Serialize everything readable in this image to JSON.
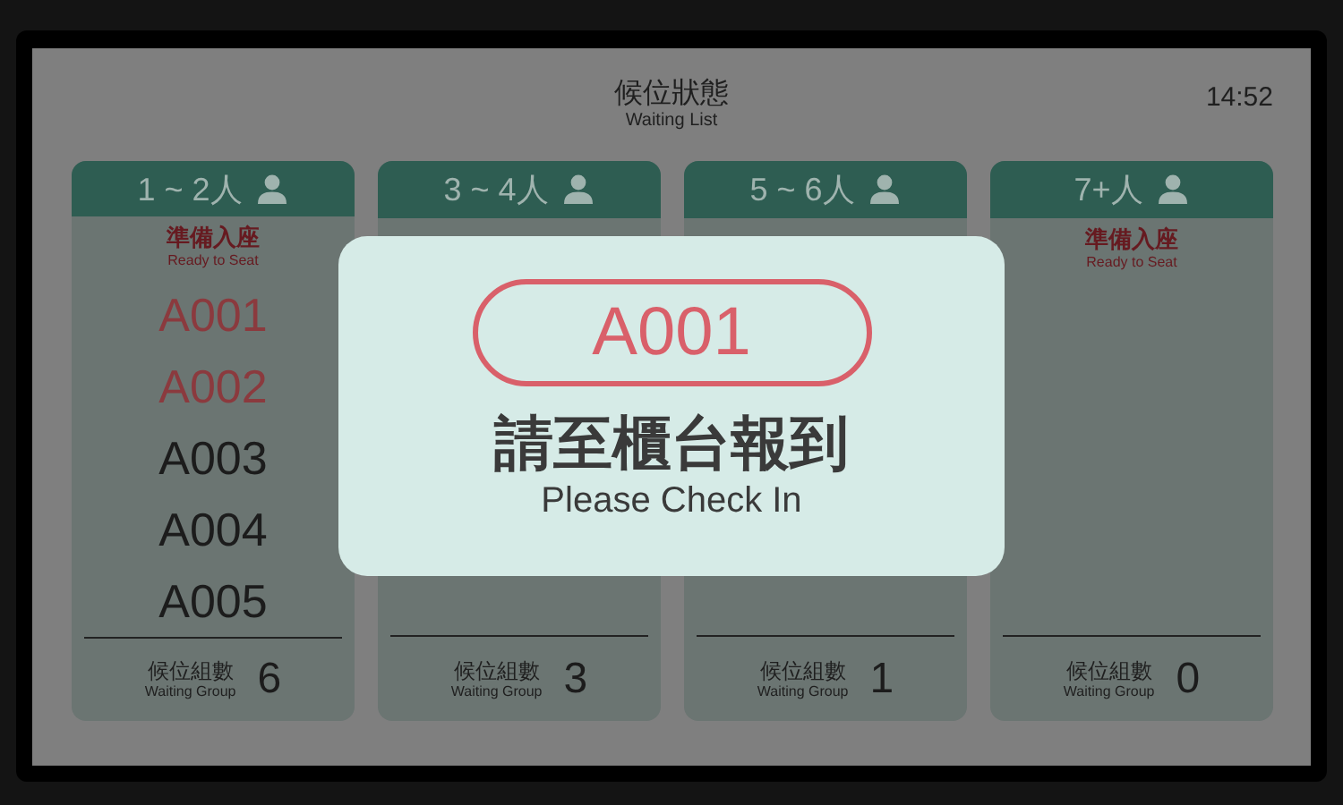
{
  "header": {
    "title": "候位狀態",
    "subtitle": "Waiting List",
    "time": "14:52"
  },
  "columns": [
    {
      "label": "1 ~ 2人",
      "ready_label": "準備入座",
      "ready_sublabel": "Ready to Seat",
      "tickets": [
        {
          "number": "A001",
          "called": true
        },
        {
          "number": "A002",
          "called": true
        },
        {
          "number": "A003",
          "called": false
        },
        {
          "number": "A004",
          "called": false
        },
        {
          "number": "A005",
          "called": false
        }
      ],
      "count_label": "候位組數",
      "count_sublabel": "Waiting Group",
      "count": "6"
    },
    {
      "label": "3 ~ 4人",
      "count_label": "候位組數",
      "count_sublabel": "Waiting Group",
      "count": "3"
    },
    {
      "label": "5 ~ 6人",
      "count_label": "候位組數",
      "count_sublabel": "Waiting Group",
      "count": "1"
    },
    {
      "label": "7+人",
      "ready_label": "準備入座",
      "ready_sublabel": "Ready to Seat",
      "count_label": "候位組數",
      "count_sublabel": "Waiting Group",
      "count": "0"
    }
  ],
  "dialog": {
    "ticket": "A001",
    "message": "請至櫃台報到",
    "message_en": "Please Check In"
  }
}
